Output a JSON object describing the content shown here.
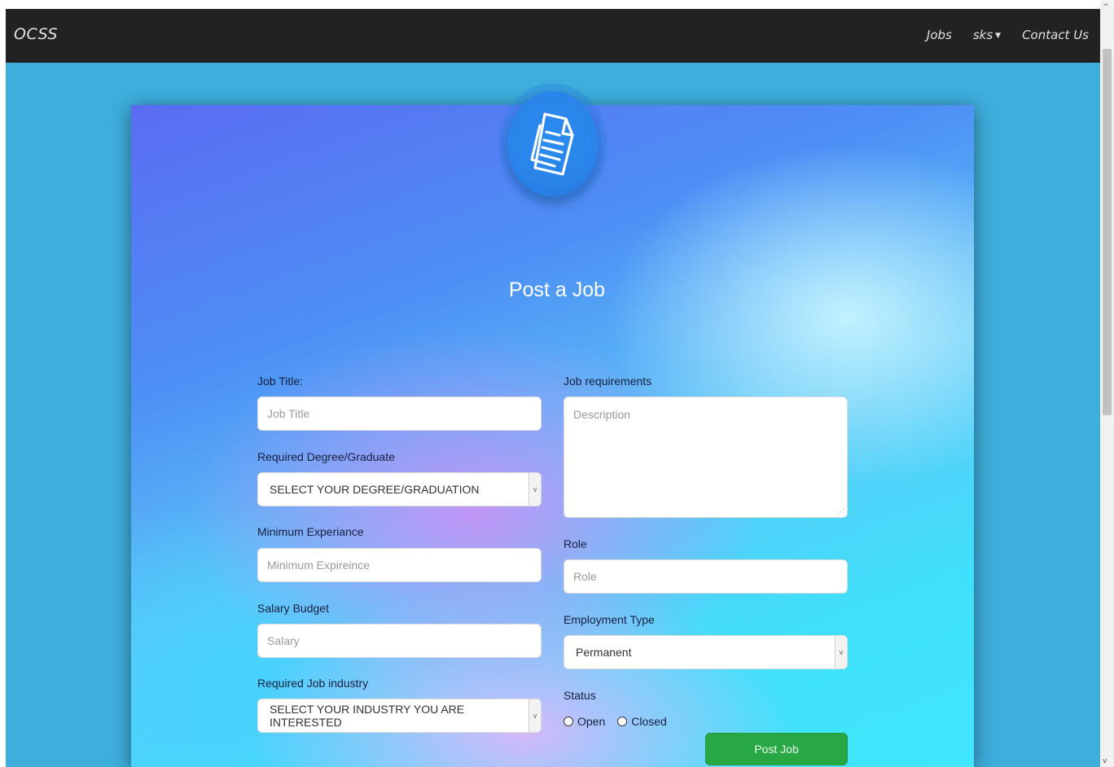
{
  "navbar": {
    "brand": "OCSS",
    "links": [
      {
        "label": "Jobs"
      },
      {
        "label": "sks"
      },
      {
        "label": "Contact Us"
      }
    ]
  },
  "form": {
    "title": "Post a Job",
    "job_title": {
      "label": "Job Title:",
      "placeholder": "Job Title"
    },
    "degree": {
      "label": "Required Degree/Graduate",
      "selected": "SELECT YOUR DEGREE/GRADUATION"
    },
    "experience": {
      "label": "Minimum Experiance",
      "placeholder": "Minimum Expireince"
    },
    "salary": {
      "label": "Salary Budget",
      "placeholder": "Salary"
    },
    "industry": {
      "label": "Required Job industry",
      "selected": "SELECT YOUR INDUSTRY YOU ARE INTERESTED"
    },
    "requirements": {
      "label": "Job requirements",
      "placeholder": "Description"
    },
    "role": {
      "label": "Role",
      "placeholder": "Role"
    },
    "employment_type": {
      "label": "Employment Type",
      "selected": "Permanent"
    },
    "status": {
      "label": "Status",
      "options": [
        "Open",
        "Closed"
      ]
    },
    "submit_label": "Post Job"
  },
  "colors": {
    "navbar_bg": "#222222",
    "page_bg": "#3eaedc",
    "submit_button": "#28a745"
  },
  "icons": {
    "logo": "document-icon",
    "nav_caret": "caret-down-icon",
    "select_arrow": "chevron-down-icon"
  }
}
